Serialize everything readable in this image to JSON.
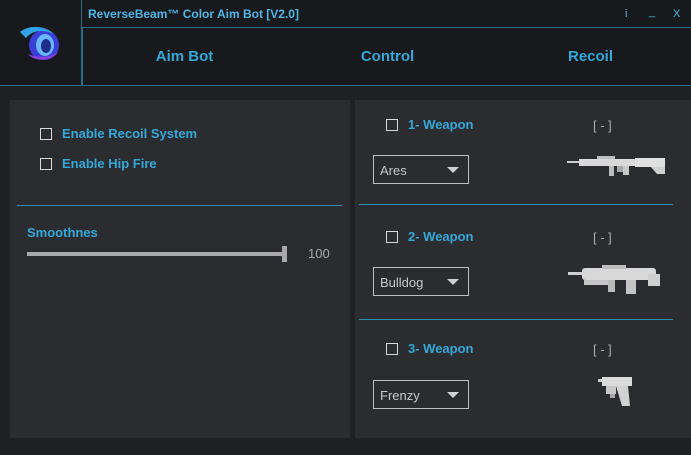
{
  "window": {
    "title": "ReverseBeam™ Color Aim Bot [V2.0]",
    "buttons": {
      "info": "i",
      "minimize": "_",
      "close": "X"
    }
  },
  "nav": {
    "tabs": [
      {
        "label": "Aim Bot"
      },
      {
        "label": "Control"
      },
      {
        "label": "Recoil"
      }
    ]
  },
  "left": {
    "options": [
      {
        "label": "Enable Recoil System",
        "checked": false
      },
      {
        "label": "Enable Hip Fire",
        "checked": false
      }
    ],
    "smoothness": {
      "label": "Smoothnes",
      "value": "100",
      "level": 100
    }
  },
  "weapons": [
    {
      "label": "1- Weapon",
      "bracket": "[ - ]",
      "selected": "Ares",
      "icon": "rifle-icon"
    },
    {
      "label": "2- Weapon",
      "bracket": "[ - ]",
      "selected": "Bulldog",
      "icon": "bullpup-rifle-icon"
    },
    {
      "label": "3- Weapon",
      "bracket": "[ - ]",
      "selected": "Frenzy",
      "icon": "pistol-icon"
    }
  ],
  "colors": {
    "accent": "#34a8d8",
    "border": "#2b6f86",
    "panel": "#2a2c30",
    "background": "#1f2024"
  }
}
